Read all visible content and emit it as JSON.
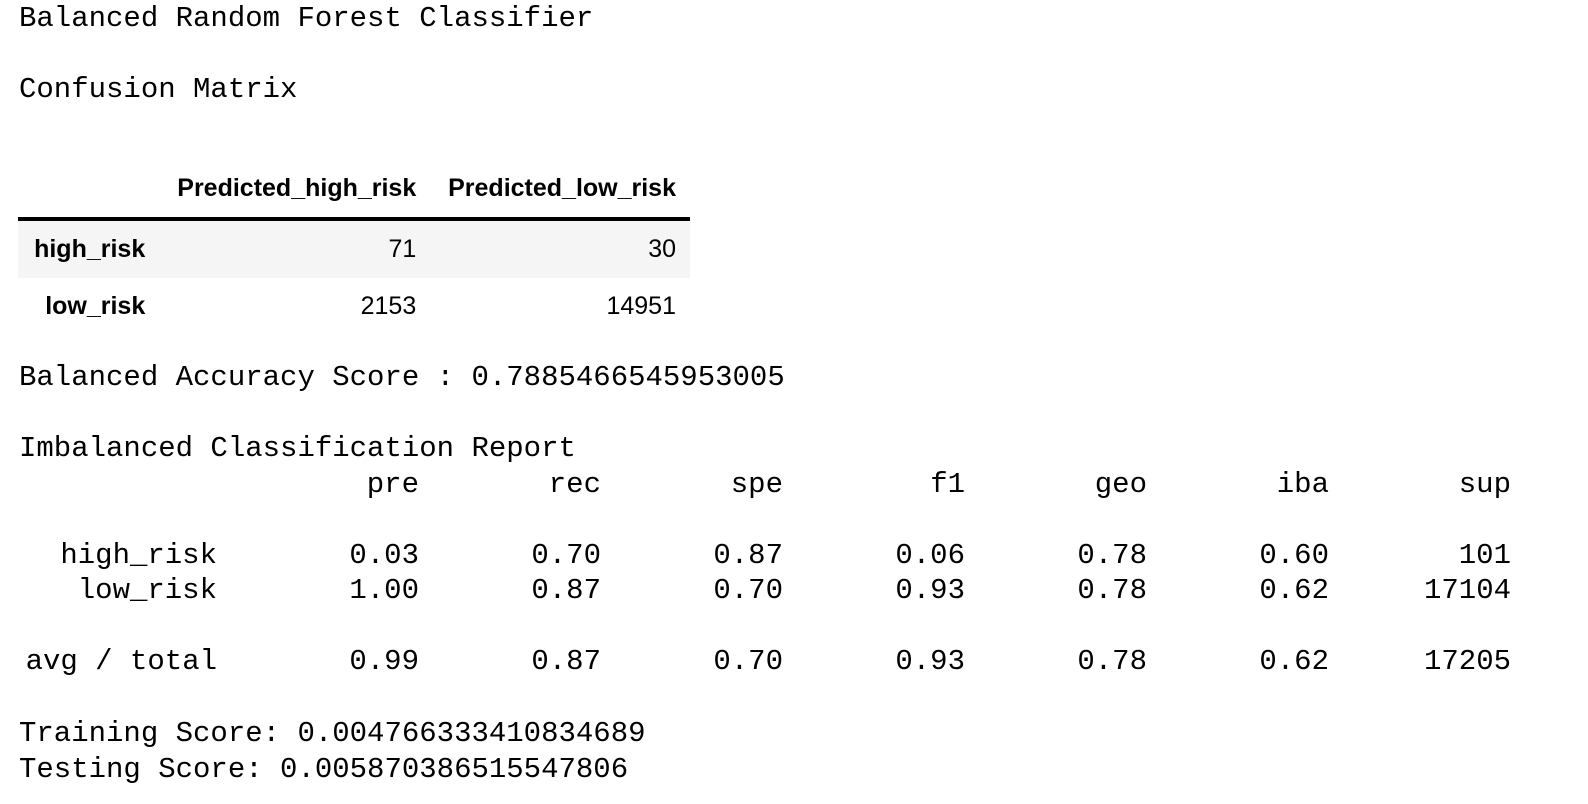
{
  "title": "Balanced Random Forest Classifier",
  "confusion_matrix": {
    "title": "Confusion Matrix",
    "columns": [
      "Predicted_high_risk",
      "Predicted_low_risk"
    ],
    "rows": [
      {
        "label": "high_risk",
        "values": [
          "71",
          "30"
        ]
      },
      {
        "label": "low_risk",
        "values": [
          "2153",
          "14951"
        ]
      }
    ]
  },
  "balanced_accuracy": "Balanced Accuracy Score : 0.7885466545953005",
  "report": {
    "title": "Imbalanced Classification Report",
    "headers": [
      "pre",
      "rec",
      "spe",
      "f1",
      "geo",
      "iba",
      "sup"
    ],
    "rows": [
      {
        "label": "high_risk",
        "values": [
          "0.03",
          "0.70",
          "0.87",
          "0.06",
          "0.78",
          "0.60",
          "101"
        ]
      },
      {
        "label": "low_risk",
        "values": [
          "1.00",
          "0.87",
          "0.70",
          "0.93",
          "0.78",
          "0.62",
          "17104"
        ]
      },
      {
        "label": "avg / total",
        "values": [
          "0.99",
          "0.87",
          "0.70",
          "0.93",
          "0.78",
          "0.62",
          "17205"
        ]
      }
    ]
  },
  "training_score": "Training Score: 0.004766333410834689",
  "testing_score": "Testing Score: 0.005870386515547806"
}
